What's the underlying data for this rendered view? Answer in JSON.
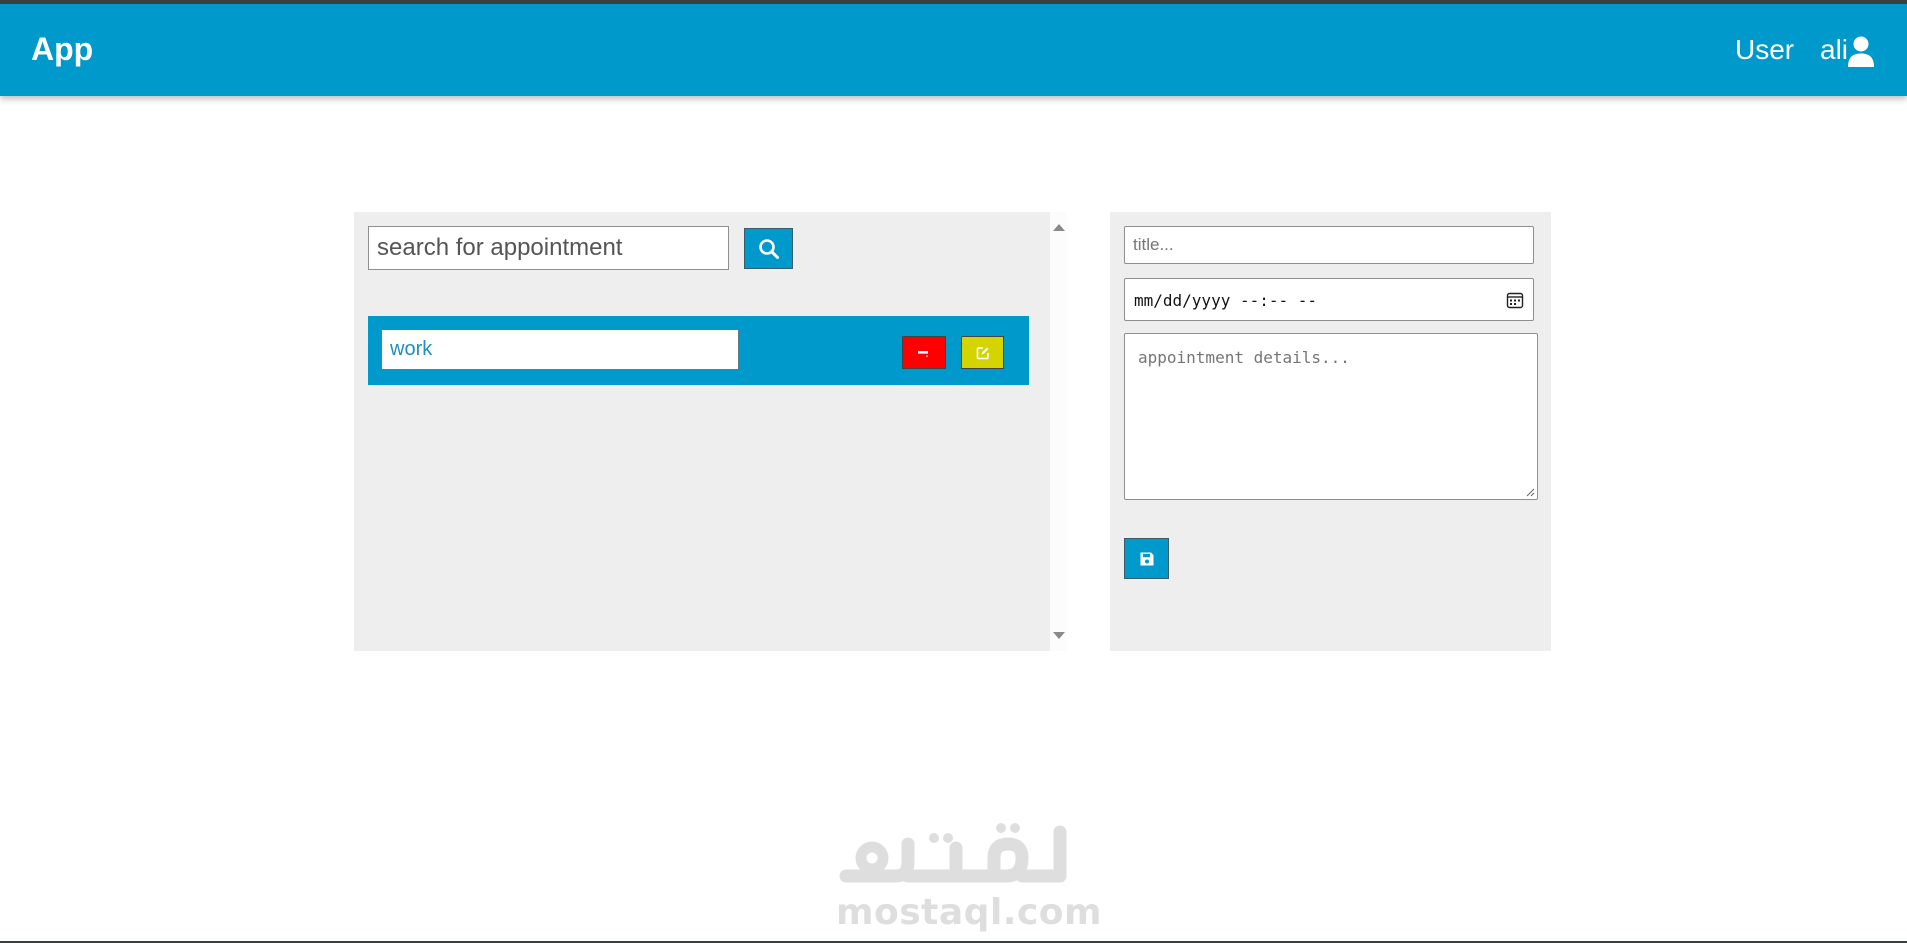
{
  "navbar": {
    "brand": "App",
    "user_label": "User",
    "user_name": "ali",
    "user_icon": "user-icon",
    "color": "#0099cb"
  },
  "search": {
    "placeholder": "search for appointment",
    "button_icon": "search-icon"
  },
  "appointments": [
    {
      "title": "work",
      "delete_icon": "minus-icon",
      "edit_icon": "edit-icon"
    }
  ],
  "form": {
    "title_placeholder": "title...",
    "datetime_placeholder": "mm/dd/yyyy --:-- --",
    "datetime_icon": "calendar-icon",
    "details_placeholder": "appointment details...",
    "save_icon": "save-icon"
  },
  "watermark": {
    "arabic": "مستقل",
    "latin": "mostaql.com"
  },
  "colors": {
    "primary": "#0099cb",
    "delete": "#ff0000",
    "edit": "#d4d400",
    "panel": "#eeeeee"
  }
}
